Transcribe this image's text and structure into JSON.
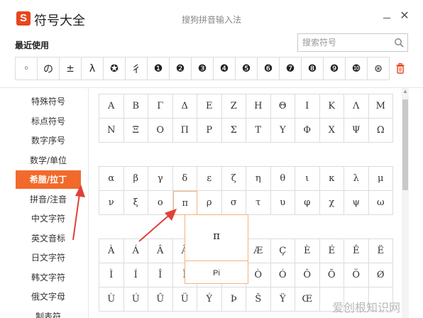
{
  "window": {
    "app_title": "符号大全",
    "ime_title": "搜狗拼音输入法",
    "logo_letter": "S",
    "minimize_glyph": "",
    "close_glyph": "✕"
  },
  "recent": {
    "label": "最近使用",
    "symbols": [
      "◦",
      "の",
      "±",
      "λ",
      "✪",
      "彳",
      "❶",
      "❷",
      "❸",
      "❹",
      "❺",
      "❻",
      "❼",
      "❽",
      "❾",
      "❿",
      "⊛"
    ]
  },
  "search": {
    "placeholder": "搜索符号"
  },
  "sidebar": {
    "items": [
      {
        "label": "特殊符号",
        "active": false
      },
      {
        "label": "标点符号",
        "active": false
      },
      {
        "label": "数字序号",
        "active": false
      },
      {
        "label": "数学/单位",
        "active": false
      },
      {
        "label": "希腊/拉丁",
        "active": true
      },
      {
        "label": "拼音/注音",
        "active": false
      },
      {
        "label": "中文字符",
        "active": false
      },
      {
        "label": "英文音标",
        "active": false
      },
      {
        "label": "日文字符",
        "active": false
      },
      {
        "label": "韩文字符",
        "active": false
      },
      {
        "label": "俄文字母",
        "active": false
      },
      {
        "label": "制表符",
        "active": false
      }
    ]
  },
  "grids": {
    "greek_upper": [
      [
        "Α",
        "Β",
        "Γ",
        "Δ",
        "Ε",
        "Ζ",
        "Η",
        "Θ",
        "Ι",
        "Κ",
        "Λ",
        "Μ"
      ],
      [
        "Ν",
        "Ξ",
        "Ο",
        "Π",
        "Ρ",
        "Σ",
        "Τ",
        "Υ",
        "Φ",
        "Χ",
        "Ψ",
        "Ω"
      ]
    ],
    "greek_lower": [
      [
        "α",
        "β",
        "γ",
        "δ",
        "ε",
        "ζ",
        "η",
        "θ",
        "ι",
        "κ",
        "λ",
        "μ"
      ],
      [
        "ν",
        "ξ",
        "ο",
        "π",
        "ρ",
        "σ",
        "τ",
        "υ",
        "φ",
        "χ",
        "ψ",
        "ω"
      ]
    ],
    "latin": [
      [
        "À",
        "Á",
        "Â",
        "Ã",
        "Ä",
        "Å",
        "Æ",
        "Ç",
        "È",
        "É",
        "Ê",
        "Ë"
      ],
      [
        "Ì",
        "Í",
        "Î",
        "Ï",
        "Ð",
        "Ñ",
        "Ò",
        "Ó",
        "Ô",
        "Õ",
        "Ö",
        "Ø"
      ],
      [
        "Ù",
        "Ú",
        "Û",
        "Ü",
        "Ý",
        "Þ",
        "Š",
        "Ÿ",
        "Œ",
        "",
        "",
        ""
      ]
    ]
  },
  "popup": {
    "symbol": "π",
    "name": "Pi"
  },
  "watermark": "爱创根知识网",
  "colors": {
    "accent": "#f26a2b",
    "arrow": "#e0403a"
  }
}
